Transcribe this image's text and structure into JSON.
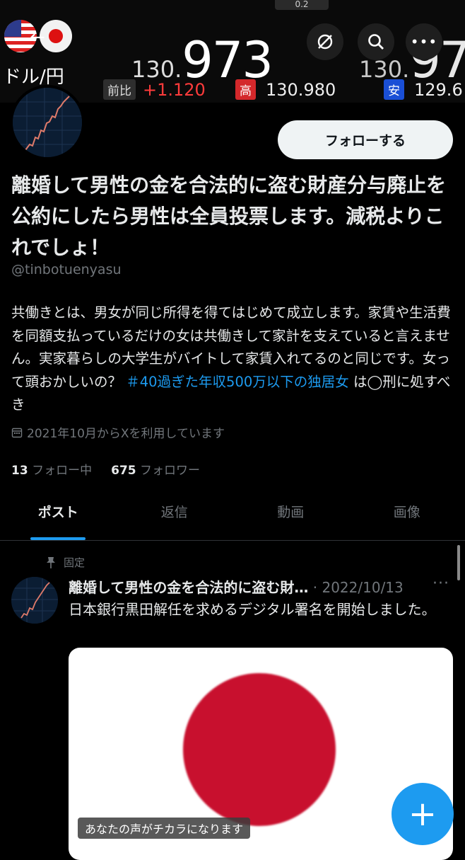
{
  "forex": {
    "chip": "0.2",
    "pair": "ドル/円",
    "rate_small": "130.",
    "rate_big": "973",
    "rate_small_2": "130.",
    "rate_big_2": "97",
    "change_label": "前比",
    "change_value": "+1.120",
    "high_label": "高",
    "high_value": "130.980",
    "low_label": "安",
    "low_value": "129.6"
  },
  "profile": {
    "follow_label": "フォローする",
    "display_name": "離婚して男性の金を合法的に盗む財産分与廃止を公約にしたら男性は全員投票します。減税よりこれでしょ！",
    "handle": "@tinbotuenyasu",
    "bio_text": "共働きとは、男女が同じ所得を得てはじめて成立します。家賃や生活費を同額支払っているだけの女は共働きして家計を支えていると言えません。実家暮らしの大学生がバイトして家賃入れてるのと同じです。女って頭おかしいの？",
    "bio_hashtag": "＃40過ぎた年収500万以下の独居女",
    "bio_tail": "は◯刑に処すべき",
    "joined": "2021年10月からXを利用しています",
    "following_count": "13",
    "following_label": "フォロー中",
    "followers_count": "675",
    "followers_label": "フォロワー"
  },
  "tabs": [
    {
      "label": "ポスト"
    },
    {
      "label": "返信"
    },
    {
      "label": "動画"
    },
    {
      "label": "画像"
    }
  ],
  "pinned_post": {
    "pinned_label": "固定",
    "author": "離婚して男性の金を合法的に盗む財…",
    "date": "· 2022/10/13",
    "more": "···",
    "text": "日本銀行黒田解任を求めるデジタル署名を開始しました。",
    "caption": "あなたの声がチカラになります"
  },
  "fab_label": "+",
  "icons": {
    "back": "arrow-left-icon",
    "sync": "sync-off-icon",
    "search": "search-icon",
    "more": "more-icon",
    "calendar": "calendar-icon",
    "pin": "pin-icon"
  },
  "colors": {
    "accent": "#1d9bf0",
    "background": "#000000",
    "muted": "#71767b",
    "up": "#ff3b3b"
  }
}
